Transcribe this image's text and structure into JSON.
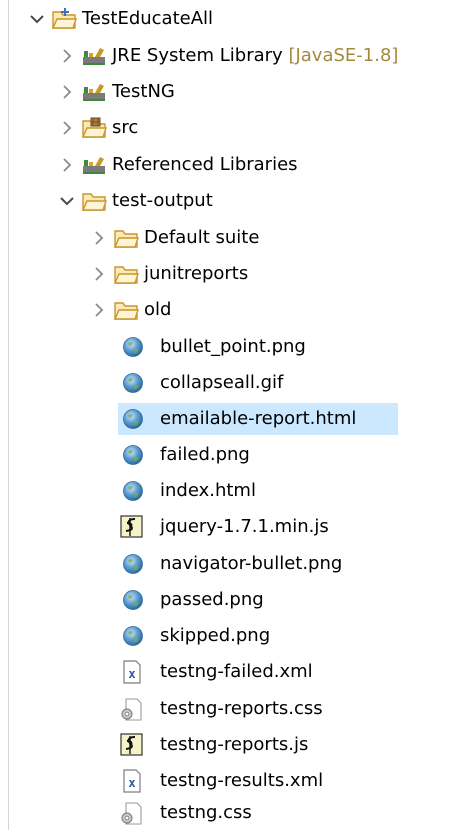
{
  "tree": {
    "root": {
      "label": "TestEducateAll",
      "icon": "project-folder-icon",
      "toggle": "expanded"
    },
    "items": [
      {
        "label": "JRE System Library",
        "decoration": "[JavaSE-1.8]",
        "icon": "library-icon"
      },
      {
        "label": "TestNG",
        "icon": "library-icon"
      },
      {
        "label": "src",
        "icon": "package-folder-icon"
      },
      {
        "label": "Referenced Libraries",
        "icon": "library-icon"
      },
      {
        "label": "test-output",
        "icon": "open-folder-icon",
        "toggle": "expanded"
      }
    ],
    "test_output_items": [
      {
        "label": "Default suite",
        "icon": "folder-icon",
        "toggle": "collapsed"
      },
      {
        "label": "junitreports",
        "icon": "folder-icon",
        "toggle": "collapsed"
      },
      {
        "label": "old",
        "icon": "folder-icon",
        "toggle": "collapsed"
      },
      {
        "label": "bullet_point.png",
        "icon": "globe-icon"
      },
      {
        "label": "collapseall.gif",
        "icon": "globe-icon"
      },
      {
        "label": "emailable-report.html",
        "icon": "globe-icon",
        "selected": true
      },
      {
        "label": "failed.png",
        "icon": "globe-icon"
      },
      {
        "label": "index.html",
        "icon": "globe-icon"
      },
      {
        "label": "jquery-1.7.1.min.js",
        "icon": "js-file-icon"
      },
      {
        "label": "navigator-bullet.png",
        "icon": "globe-icon"
      },
      {
        "label": "passed.png",
        "icon": "globe-icon"
      },
      {
        "label": "skipped.png",
        "icon": "globe-icon"
      },
      {
        "label": "testng-failed.xml",
        "icon": "xml-file-icon"
      },
      {
        "label": "testng-reports.css",
        "icon": "css-file-icon"
      },
      {
        "label": "testng-reports.js",
        "icon": "js-file-icon"
      },
      {
        "label": "testng-results.xml",
        "icon": "xml-file-icon"
      },
      {
        "label": "testng.css",
        "icon": "css-file-icon"
      }
    ]
  },
  "colors": {
    "selection": "#cce8ff",
    "decoration": "#a58a3c",
    "folder": "#e8b547",
    "globe": "#4a90c8"
  }
}
